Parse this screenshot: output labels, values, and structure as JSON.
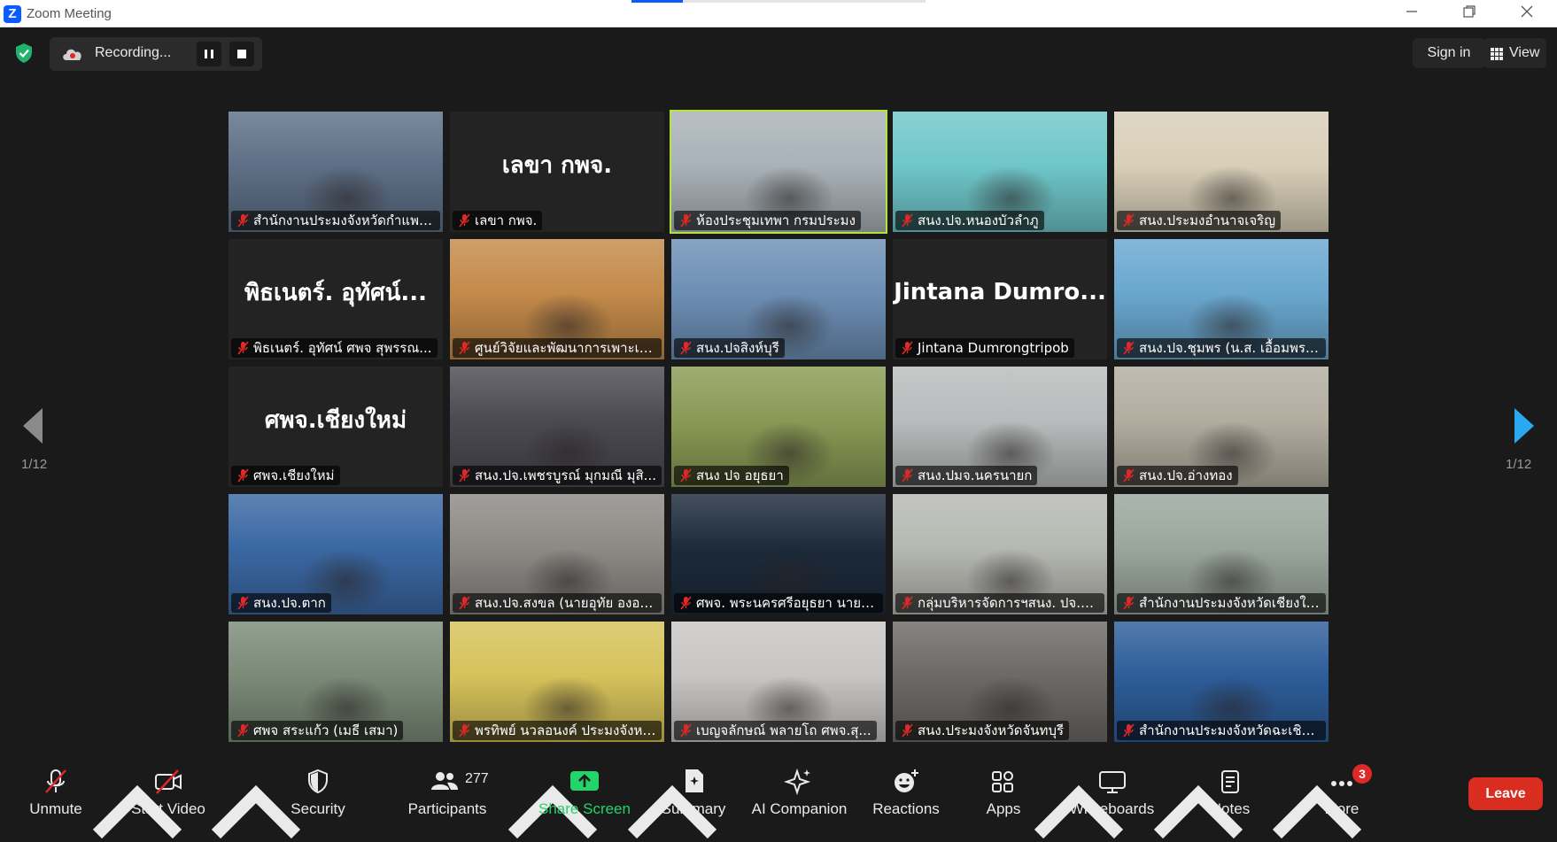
{
  "window": {
    "title": "Zoom Meeting",
    "logo_letter": "Z",
    "minimize_icon": "minimize-icon",
    "restore_icon": "restore-icon",
    "close_icon": "close-icon"
  },
  "topbar": {
    "recording_label": "Recording...",
    "sign_in": "Sign in",
    "view": "View"
  },
  "gallery": {
    "page_indicator_left": "1/12",
    "page_indicator_right": "1/12",
    "tiles": [
      {
        "label": "สำนักงานประมงจังหวัดกำแพงเ...",
        "display": "",
        "bg": "#5e6f86",
        "active": false
      },
      {
        "label": "เลขา กพจ.",
        "display": "เลขา กพจ.",
        "bg": "",
        "active": false
      },
      {
        "label": "ห้องประชุมเทพา กรมประมง",
        "display": "",
        "bg": "#a9b2b8",
        "active": true
      },
      {
        "label": "สนง.ปจ.หนองบัวลำภู",
        "display": "",
        "bg": "#6fc6c9",
        "active": false
      },
      {
        "label": "สนง.ประมงอำนาจเจริญ",
        "display": "",
        "bg": "#d8cfb8",
        "active": false
      },
      {
        "label": "พิธเนตร์. อุทัศน์ ศพจ สุพรรณ...",
        "display": "พิธเนตร์. อุทัศน์...",
        "bg": "",
        "active": false
      },
      {
        "label": "ศูนย์วิจัยและพัฒนาการเพาะเลี้...",
        "display": "",
        "bg": "#c38a4a",
        "active": false
      },
      {
        "label": "สนง.ปจสิงห์บุรี",
        "display": "",
        "bg": "#6d8fb5",
        "active": false
      },
      {
        "label": "Jintana Dumrongtripob",
        "display": "Jintana  Dumro...",
        "bg": "",
        "active": false
      },
      {
        "label": "สนง.ปจ.ชุมพร (น.ส. เอื้อมพร ...",
        "display": "",
        "bg": "#6aa7cf",
        "active": false
      },
      {
        "label": "ศพจ.เชียงใหม่",
        "display": "ศพจ.เชียงใหม่",
        "bg": "",
        "active": false
      },
      {
        "label": "สนง.ปจ.เพชรบูรณ์ มุกมณี มุสิ...",
        "display": "",
        "bg": "#4b4a52",
        "active": false
      },
      {
        "label": "สนง ปจ อยุธยา",
        "display": "",
        "bg": "#8a9a55",
        "active": false
      },
      {
        "label": "สนง.ปมจ.นครนายก",
        "display": "",
        "bg": "#b9bcbc",
        "active": false
      },
      {
        "label": "สนง.ปจ.อ่างทอง",
        "display": "",
        "bg": "#b2ad9f",
        "active": false
      },
      {
        "label": "สนง.ปจ.ตาก",
        "display": "",
        "bg": "#3b68a3",
        "active": false
      },
      {
        "label": "สนง.ปจ.สงขล (นายอุทัย องอา...",
        "display": "",
        "bg": "#8c8a85",
        "active": false
      },
      {
        "label": "ศพจ. พระนครศรีอยุธยา นายจ...",
        "display": "",
        "bg": "#1c2a3a",
        "active": false
      },
      {
        "label": "กลุ่มบริหารจัดการฯสนง. ปจ.ก...",
        "display": "",
        "bg": "#b6b8b2",
        "active": false
      },
      {
        "label": "สำนักงานประมงจังหวัดเชียงใหม่",
        "display": "",
        "bg": "#9aa69c",
        "active": false
      },
      {
        "label": "ศพจ สระแก้ว (เมธี เสมา)",
        "display": "",
        "bg": "#7b8b78",
        "active": false
      },
      {
        "label": "พรทิพย์ นวลอนงค์ ประมงจังหว...",
        "display": "",
        "bg": "#d6c25a",
        "active": false
      },
      {
        "label": "เบญจลักษณ์ พลายโถ ศพจ.สุ...",
        "display": "",
        "bg": "#c8c6c4",
        "active": false
      },
      {
        "label": "สนง.ประมงจังหวัดจันทบุรี",
        "display": "",
        "bg": "#6c6a66",
        "active": false
      },
      {
        "label": "สำนักงานประมงจังหวัดฉะเชิงเ...",
        "display": "",
        "bg": "#2e5d9a",
        "active": false
      }
    ]
  },
  "toolbar": {
    "unmute": "Unmute",
    "start_video": "Start Video",
    "security": "Security",
    "participants": "Participants",
    "participants_count": "277",
    "share_screen": "Share Screen",
    "summary": "Summary",
    "ai_companion": "AI Companion",
    "reactions": "Reactions",
    "apps": "Apps",
    "whiteboards": "Whiteboards",
    "notes": "Notes",
    "more": "More",
    "more_badge": "3",
    "leave": "Leave"
  },
  "colors": {
    "accent": "#0b5cff",
    "active_speaker": "#b5e33a",
    "share_green": "#23d46b",
    "leave_red": "#d92d20",
    "muted_red": "#e02828"
  }
}
